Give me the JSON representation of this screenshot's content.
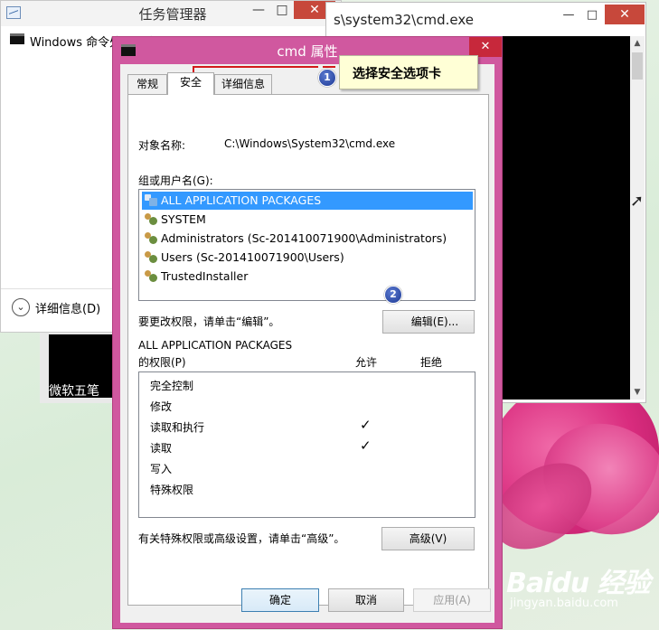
{
  "taskmgr": {
    "title": "任务管理器",
    "minimize": "—",
    "maximize": "□",
    "close": "✕",
    "process_item": "Windows 命令处理程序",
    "more_details_icon": "⌄",
    "more_details": "详细信息(D)"
  },
  "thumbnail": {
    "label": "微软五笔"
  },
  "cmd_window": {
    "title": "s\\system32\\cmd.exe",
    "minimize": "—",
    "maximize": "□",
    "close": "✕",
    "scroll_up": "▲",
    "scroll_down": "▼"
  },
  "dialog": {
    "title": "cmd 属性",
    "close": "✕",
    "tabs": [
      "常规",
      "安全",
      "详细信息"
    ],
    "active_tab": "安全",
    "object_name_label": "对象名称:",
    "object_name_value": "C:\\Windows\\System32\\cmd.exe",
    "group_label": "组或用户名(G):",
    "users": [
      "ALL APPLICATION PACKAGES",
      "SYSTEM",
      "Administrators (Sc-201410071900\\Administrators)",
      "Users (Sc-201410071900\\Users)",
      "TrustedInstaller"
    ],
    "selected_user": "ALL APPLICATION PACKAGES",
    "change_text": "要更改权限，请单击“编辑”。",
    "edit_button": "编辑(E)...",
    "perm_for": "ALL APPLICATION PACKAGES",
    "perm_for2": "的权限(P)",
    "allow_header": "允许",
    "deny_header": "拒绝",
    "permissions": [
      {
        "name": "完全控制",
        "allow": "",
        "deny": ""
      },
      {
        "name": "修改",
        "allow": "",
        "deny": ""
      },
      {
        "name": "读取和执行",
        "allow": "✓",
        "deny": ""
      },
      {
        "name": "读取",
        "allow": "✓",
        "deny": ""
      },
      {
        "name": "写入",
        "allow": "",
        "deny": ""
      },
      {
        "name": "特殊权限",
        "allow": "",
        "deny": ""
      }
    ],
    "advanced_text": "有关特殊权限或高级设置，请单击“高级”。",
    "advanced_button": "高级(V)",
    "ok_button": "确定",
    "cancel_button": "取消",
    "apply_button": "应用(A)"
  },
  "annotation": {
    "step1_number": "1",
    "step1_text": "选择安全选项卡",
    "step2_number": "2"
  },
  "watermark": {
    "logo": "Baidu 经验",
    "url": "jingyan.baidu.com"
  },
  "cursor": "➚",
  "colors": {
    "dialog_frame": "#d0589f",
    "close_red": "#c7483b",
    "selection_blue": "#3399ff",
    "annotation_line": "#d21b1b",
    "badge_blue": "#1c3894",
    "callout_bg": "#ffffd6"
  }
}
